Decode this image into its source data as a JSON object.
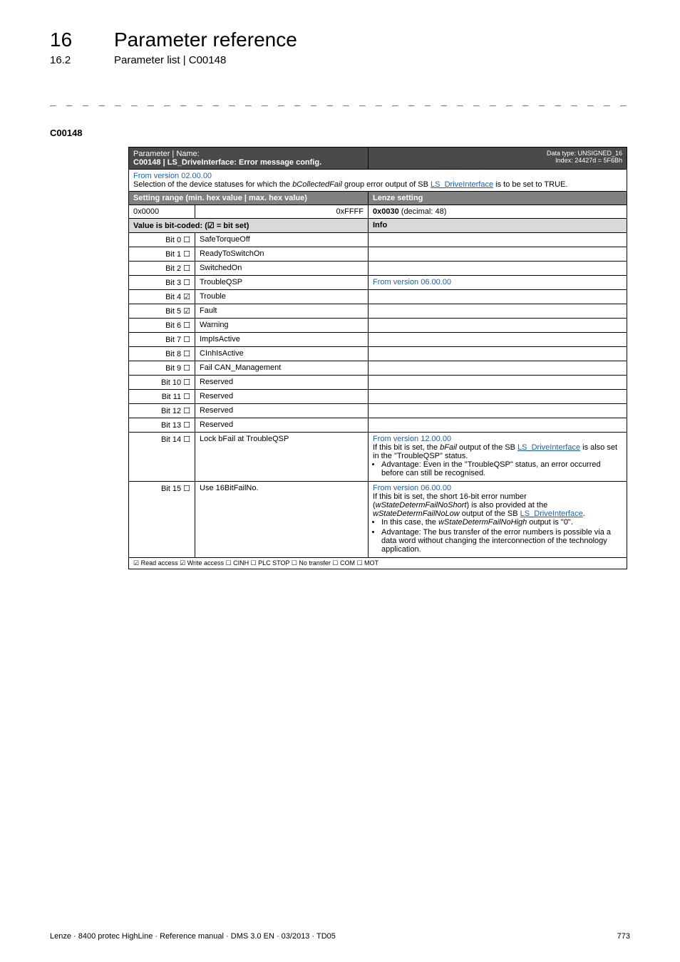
{
  "header": {
    "chapter_number": "16",
    "chapter_title": "Parameter reference",
    "sub_number": "16.2",
    "sub_title": "Parameter list | C00148"
  },
  "dash_rule": "_ _ _ _ _ _ _ _ _ _ _ _ _ _ _ _ _ _ _ _ _ _ _ _ _ _ _ _ _ _ _ _ _ _ _ _ _ _ _ _ _ _ _ _ _ _ _ _ _ _ _ _ _ _ _ _ _ _ _ _ _ _ _ _",
  "code_label": "C00148",
  "table": {
    "param_label": "Parameter | Name:",
    "param_name": "C00148 | LS_DriveInterface: Error message config.",
    "data_type_line1": "Data type: UNSIGNED_16",
    "data_type_line2": "Index: 24427d = 5F6Bh",
    "from_version_top": "From version 02.00.00",
    "desc_pre": "Selection of the device statuses for which the ",
    "desc_ital": "bCollectedFail",
    "desc_mid": " group error output of SB ",
    "desc_link": "LS_DriveInterface",
    "desc_post": " is to be set to TRUE.",
    "setting_range": "Setting range (min. hex value | max. hex value)",
    "lenze_setting": "Lenze setting",
    "range_min": "0x0000",
    "range_max": "0xFFFF",
    "default_hex": "0x0030",
    "default_dec": "  (decimal: 48)",
    "bitcoded": "Value is bit-coded:  (☑ = bit set)",
    "info_hdr": "Info",
    "bits": [
      {
        "bit": "Bit 0 ☐",
        "name": "SafeTorqueOff",
        "info": ""
      },
      {
        "bit": "Bit 1 ☐",
        "name": "ReadyToSwitchOn",
        "info": ""
      },
      {
        "bit": "Bit 2 ☐",
        "name": "SwitchedOn",
        "info": ""
      },
      {
        "bit": "Bit 3 ☐",
        "name": "TroubleQSP",
        "info": "From version 06.00.00"
      },
      {
        "bit": "Bit 4 ☑",
        "name": "Trouble",
        "info": ""
      },
      {
        "bit": "Bit 5 ☑",
        "name": "Fault",
        "info": ""
      },
      {
        "bit": "Bit 6 ☐",
        "name": "Warning",
        "info": ""
      },
      {
        "bit": "Bit 7 ☐",
        "name": "ImpIsActive",
        "info": ""
      },
      {
        "bit": "Bit 8 ☐",
        "name": "CInhIsActive",
        "info": ""
      },
      {
        "bit": "Bit 9 ☐",
        "name": "Fail CAN_Management",
        "info": ""
      },
      {
        "bit": "Bit 10 ☐",
        "name": "Reserved",
        "info": ""
      },
      {
        "bit": "Bit 11 ☐",
        "name": "Reserved",
        "info": ""
      },
      {
        "bit": "Bit 12 ☐",
        "name": "Reserved",
        "info": ""
      },
      {
        "bit": "Bit 13 ☐",
        "name": "Reserved",
        "info": ""
      }
    ],
    "bit14": {
      "bit": "Bit 14 ☐",
      "name": "Lock bFail at TroubleQSP",
      "fv": "From version 12.00.00",
      "l1a": "If this bit is set, the ",
      "l1b": "bFail",
      "l1c": " output of the SB ",
      "l1link": "LS_DriveInterface",
      "l1d": " is also set in the \"TroubleQSP\" status.",
      "bul": "Advantage: Even in the \"TroubleQSP\" status, an error occurred before can still be recognised."
    },
    "bit15": {
      "bit": "Bit 15 ☐",
      "name": "Use 16BitFailNo.",
      "fv": "From version 06.00.00",
      "l1": "If this bit is set, the short 16-bit error number (",
      "l1i": "wStateDetermFailNoShort",
      "l1p": ") is also provided at the ",
      "l1i2": "wStateDetermFailNoLow",
      "l1p2": " output of the SB ",
      "l1link": "LS_DriveInterface",
      "l1end": ".",
      "b1a": "In this case, the ",
      "b1i": "wStateDetermFailNoHigh",
      "b1b": " output is \"0\".",
      "b2": "Advantage: The bus transfer of the error numbers is possible via a data word without changing the interconnection of the technology application."
    },
    "access_row": "☑ Read access   ☑ Write access   ☐ CINH   ☐ PLC STOP   ☐ No transfer   ☐ COM   ☐ MOT"
  },
  "footer": {
    "left": "Lenze · 8400 protec HighLine · Reference manual · DMS 3.0 EN · 03/2013 · TD05",
    "right": "773"
  }
}
